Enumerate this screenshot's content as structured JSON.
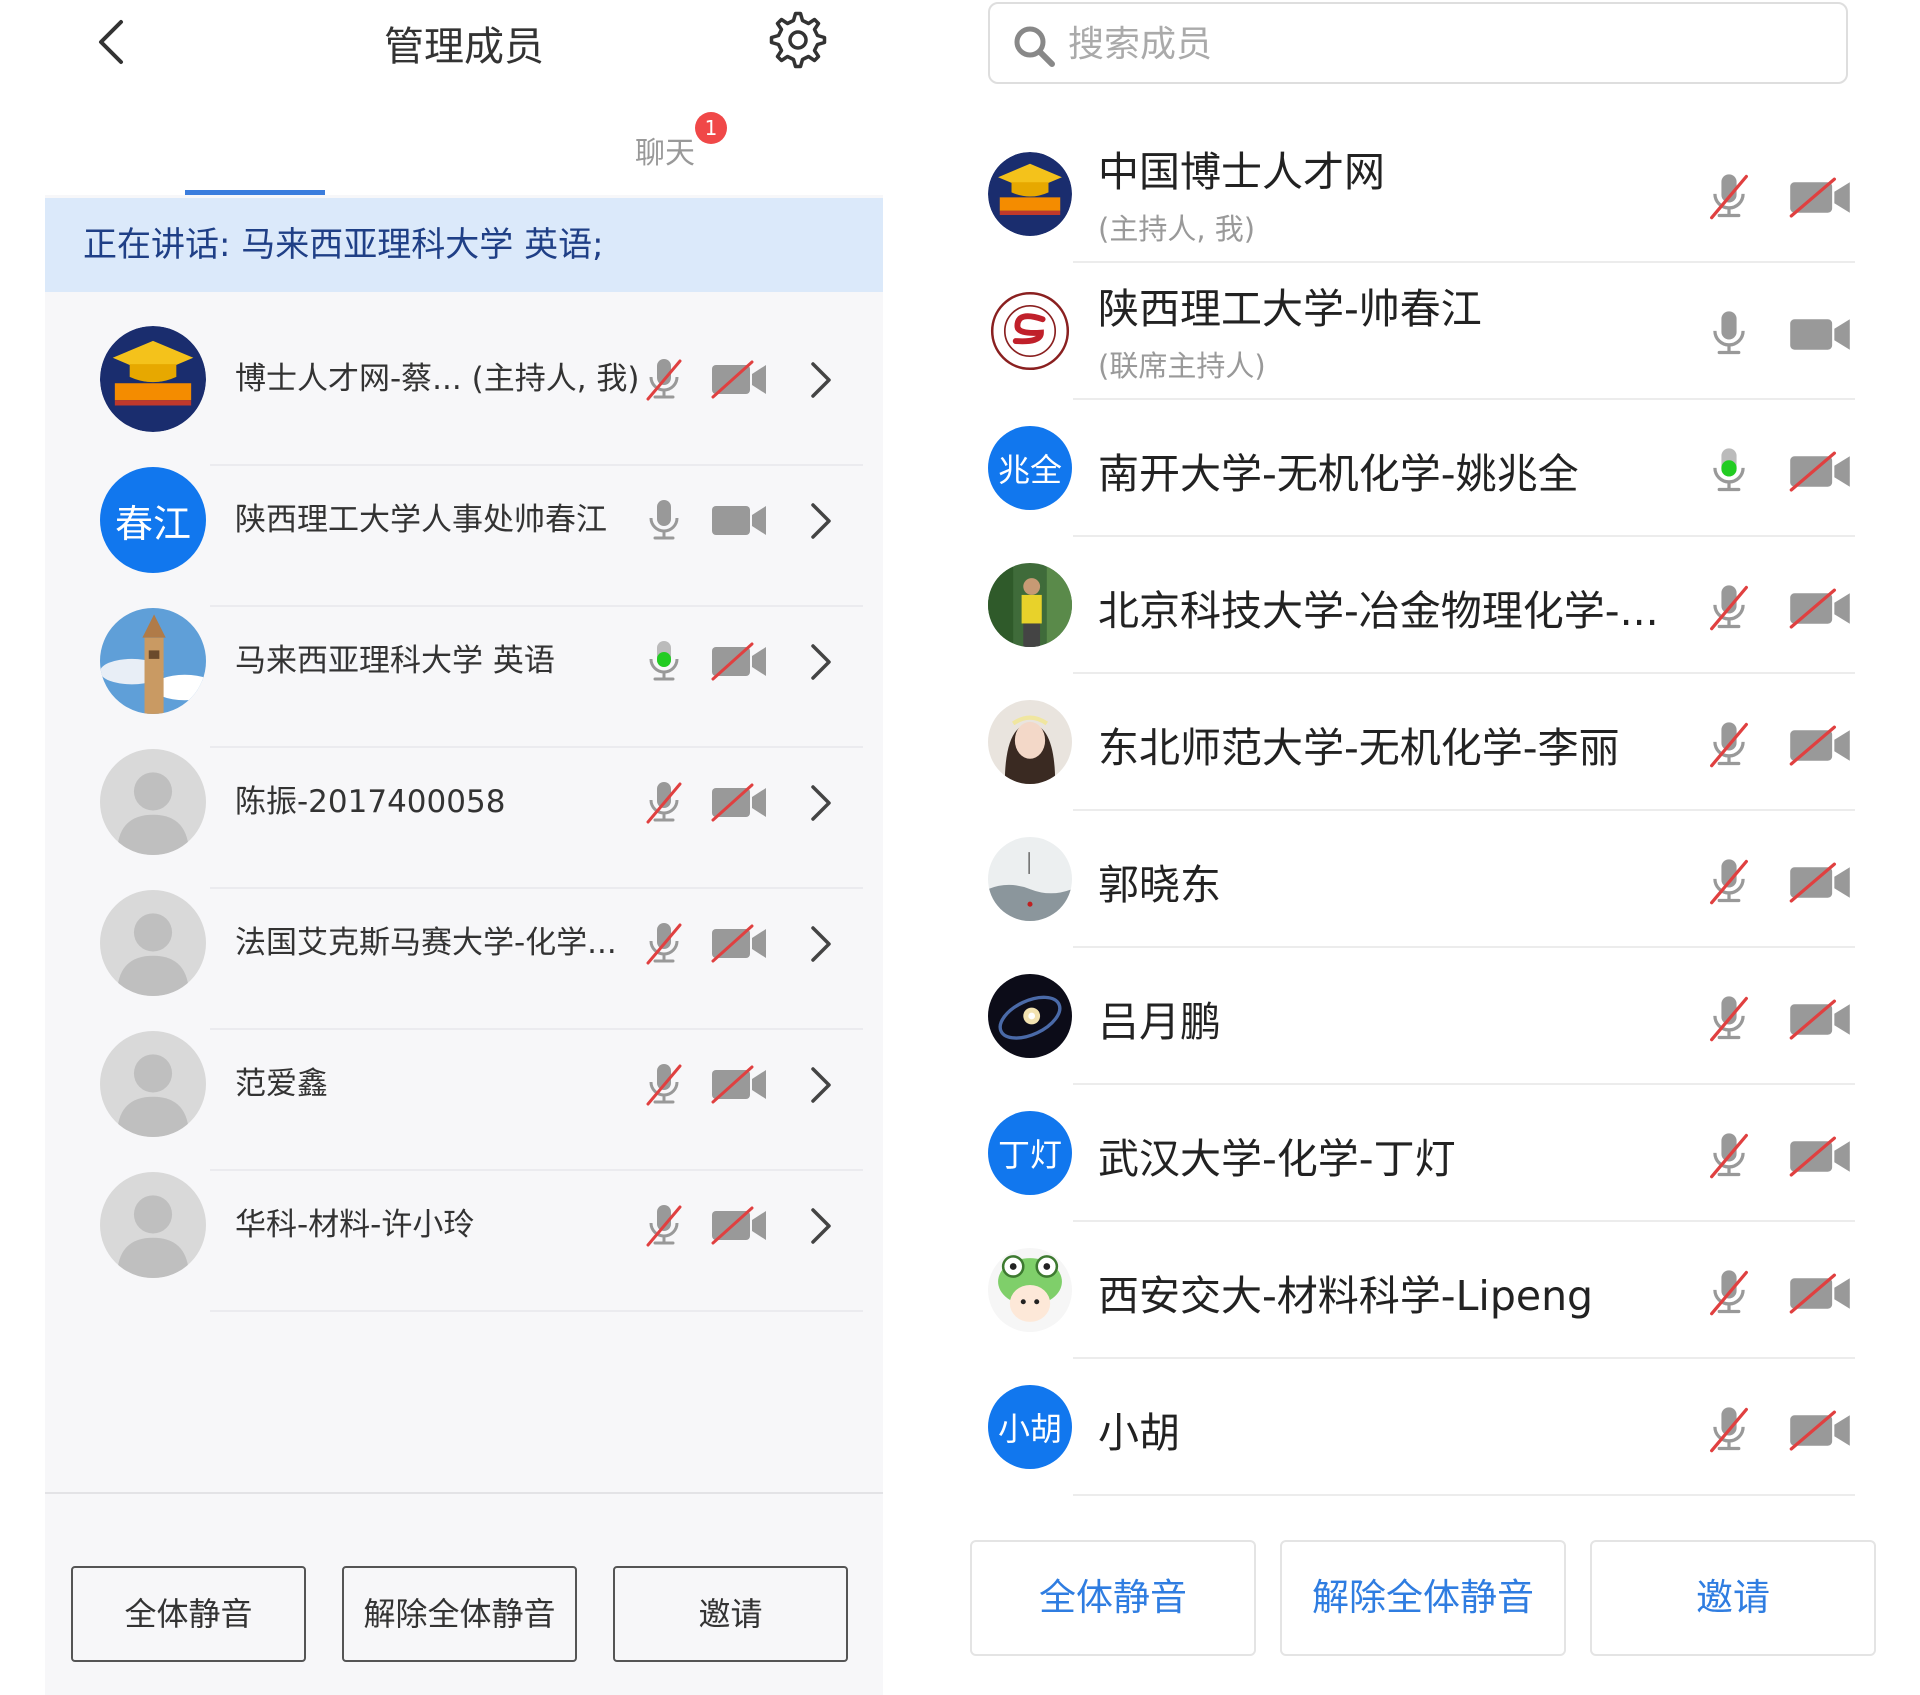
{
  "left": {
    "title": "管理成员",
    "tabs": {
      "chat_label": "聊天",
      "chat_badge": "1"
    },
    "speaking": "正在讲话: 马来西亚理科大学 英语;",
    "members": [
      {
        "name": "博士人才网-蔡... (主持人, 我)",
        "avatar": "logo",
        "mic": "muted",
        "cam": "off"
      },
      {
        "name": "陕西理工大学人事处帅春江",
        "avatar": "initials",
        "initials": "春江",
        "mic": "on",
        "cam": "on"
      },
      {
        "name": "马来西亚理科大学 英语",
        "avatar": "photo-tower",
        "mic": "speaking",
        "cam": "off"
      },
      {
        "name": "陈振-2017400058",
        "avatar": "default",
        "mic": "muted",
        "cam": "off"
      },
      {
        "name": "法国艾克斯马赛大学-化学...",
        "avatar": "default",
        "mic": "muted",
        "cam": "off"
      },
      {
        "name": "范爱鑫",
        "avatar": "default",
        "mic": "muted",
        "cam": "off"
      },
      {
        "name": "华科-材料-许小玲",
        "avatar": "default",
        "mic": "muted",
        "cam": "off"
      }
    ],
    "buttons": {
      "mute_all": "全体静音",
      "unmute_all": "解除全体静音",
      "invite": "邀请"
    }
  },
  "right": {
    "search_placeholder": "搜索成员",
    "members": [
      {
        "name": "中国博士人才网",
        "role": "(主持人, 我)",
        "avatar": "logo",
        "mic": "muted",
        "cam": "off"
      },
      {
        "name": "陕西理工大学-帅春江",
        "role": "(联席主持人)",
        "avatar": "seal",
        "mic": "on",
        "cam": "on"
      },
      {
        "name": "南开大学-无机化学-姚兆全",
        "role": "",
        "avatar": "initials",
        "initials": "兆全",
        "mic": "speaking",
        "cam": "off"
      },
      {
        "name": "北京科技大学-冶金物理化学-...",
        "role": "",
        "avatar": "photo-person",
        "mic": "muted",
        "cam": "off"
      },
      {
        "name": "东北师范大学-无机化学-李丽",
        "role": "",
        "avatar": "photo-girl",
        "mic": "muted",
        "cam": "off"
      },
      {
        "name": "郭晓东",
        "role": "",
        "avatar": "photo-landscape",
        "mic": "muted",
        "cam": "off"
      },
      {
        "name": "吕月鹏",
        "role": "",
        "avatar": "photo-galaxy",
        "mic": "muted",
        "cam": "off"
      },
      {
        "name": "武汉大学-化学-丁灯",
        "role": "",
        "avatar": "initials",
        "initials": "丁灯",
        "mic": "muted",
        "cam": "off"
      },
      {
        "name": "西安交大-材料科学-Lipeng",
        "role": "",
        "avatar": "cartoon-frog",
        "mic": "muted",
        "cam": "off"
      },
      {
        "name": "小胡",
        "role": "",
        "avatar": "initials",
        "initials": "小胡",
        "mic": "muted",
        "cam": "off"
      }
    ],
    "buttons": {
      "mute_all": "全体静音",
      "unmute_all": "解除全体静音",
      "invite": "邀请"
    }
  },
  "colors": {
    "accent": "#1177ee",
    "speaking_green": "#22cc22",
    "muted_red": "#e04040",
    "icon_gray": "#999999"
  }
}
